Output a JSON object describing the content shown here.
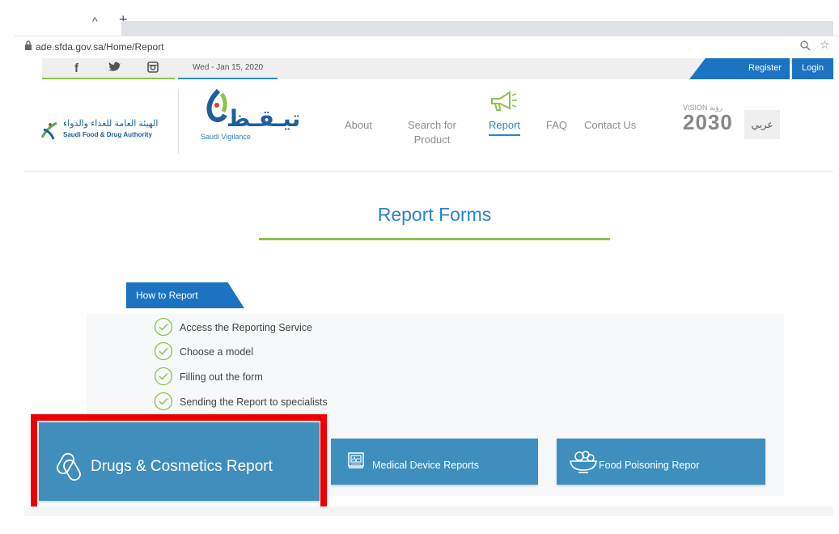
{
  "browser": {
    "url": "ade.sfda.gov.sa/Home/Report",
    "tab_collapse": "^",
    "new_tab": "+"
  },
  "topbar": {
    "social": [
      "f",
      "✓",
      "▣"
    ],
    "date": "Wed - Jan 15, 2020",
    "register": "Register",
    "login": "Login"
  },
  "header": {
    "sfda_name_ar": "الهيئة العامة للغذاء والدواء",
    "sfda_name_en": "Saudi Food & Drug Authority",
    "sv_name_ar": "تيـقـظ",
    "sv_name_en": "Saudi Vigilance",
    "nav": {
      "about": "About",
      "search_line1": "Search for",
      "search_line2": "Product",
      "report": "Report",
      "faq": "FAQ",
      "contact": "Contact Us"
    },
    "vision_top": "VISION رؤية",
    "vision_year": "2030",
    "arabic": "عربي"
  },
  "main": {
    "title": "Report Forms",
    "how_to_tab": "How to Report",
    "steps": [
      "Access the Reporting Service",
      "Choose a model",
      "Filling out the form",
      "Sending the Report to specialists"
    ],
    "cards": {
      "drugs": "Drugs & Cosmetics Report",
      "medical": "Medical Device Reports",
      "food": "Food Poisoning Repor"
    }
  },
  "colors": {
    "accent_blue": "#1b73c2",
    "card_blue": "#3e8fbd",
    "green_rule": "#8bc34a",
    "highlight_red": "#ee0000"
  }
}
